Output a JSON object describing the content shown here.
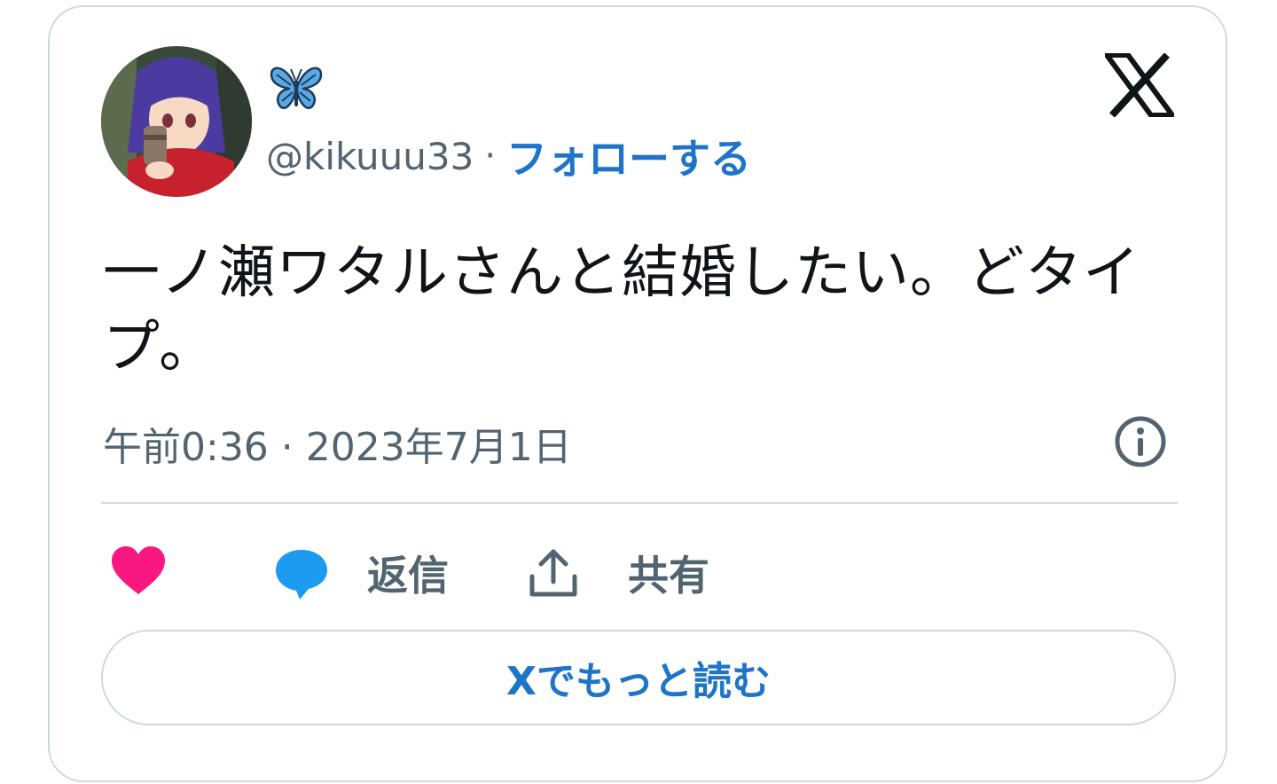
{
  "tweet": {
    "author": {
      "display_name_icon": "butterfly-icon",
      "handle": "@kikuuu33",
      "separator": "·",
      "follow_label": "フォローする"
    },
    "text": "一ノ瀬ワタルさんと結婚したい。どタイプ。",
    "timestamp": "午前0:36 · 2023年7月1日",
    "actions": {
      "like_icon": "heart-icon",
      "reply_icon": "speech-bubble-icon",
      "reply_label": "返信",
      "share_icon": "share-upload-icon",
      "share_label": "共有"
    },
    "read_more_label": "Xでもっと読む"
  },
  "colors": {
    "link_blue": "#1d74c9",
    "secondary_text": "#536471",
    "primary_text": "#0f1419",
    "border": "#cfd9de",
    "heart": "#f91880",
    "reply_bubble": "#1d9bf0",
    "butterfly": "#5aa9e6"
  }
}
